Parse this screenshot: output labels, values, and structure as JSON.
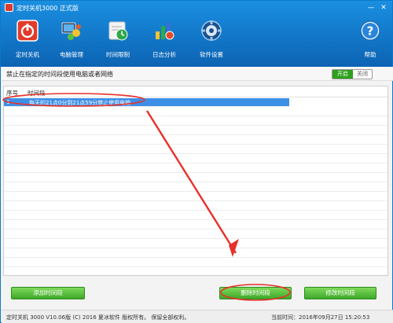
{
  "window": {
    "title": "定时关机3000 正式版",
    "minimize": "—",
    "close": "✕"
  },
  "toolbar": [
    {
      "label": "定时关机",
      "icon": "power-icon"
    },
    {
      "label": "电脑管理",
      "icon": "computer-manage-icon"
    },
    {
      "label": "时间限制",
      "icon": "clock-limit-icon"
    },
    {
      "label": "日志分析",
      "icon": "chart-log-icon"
    },
    {
      "label": "软件设置",
      "icon": "gear-icon"
    },
    {
      "label": "帮助",
      "icon": "help-icon"
    }
  ],
  "section": {
    "title": "禁止在指定的时间段使用电脑或者网络",
    "toggle_on": "开启",
    "toggle_off": "关闭"
  },
  "table": {
    "columns": [
      "序号",
      "时间段"
    ],
    "rows": [
      {
        "no": "1",
        "text": "每天的21点0分到21点59分禁止使用电脑"
      }
    ]
  },
  "buttons": {
    "add": "添加时间段",
    "delete": "删除时间段",
    "modify": "修改时间段"
  },
  "status": {
    "left": "定时关机 3000 V10.06版 (C) 2016  夏冰软件 版权所有。 保留全部权利。",
    "right": "当前时间：2016年09月27日 15:20:53"
  },
  "colors": {
    "header": "#1277c8",
    "accent_green": "#3ea82a",
    "selection": "#3d8fe6",
    "annotation_red": "#e8302a"
  }
}
